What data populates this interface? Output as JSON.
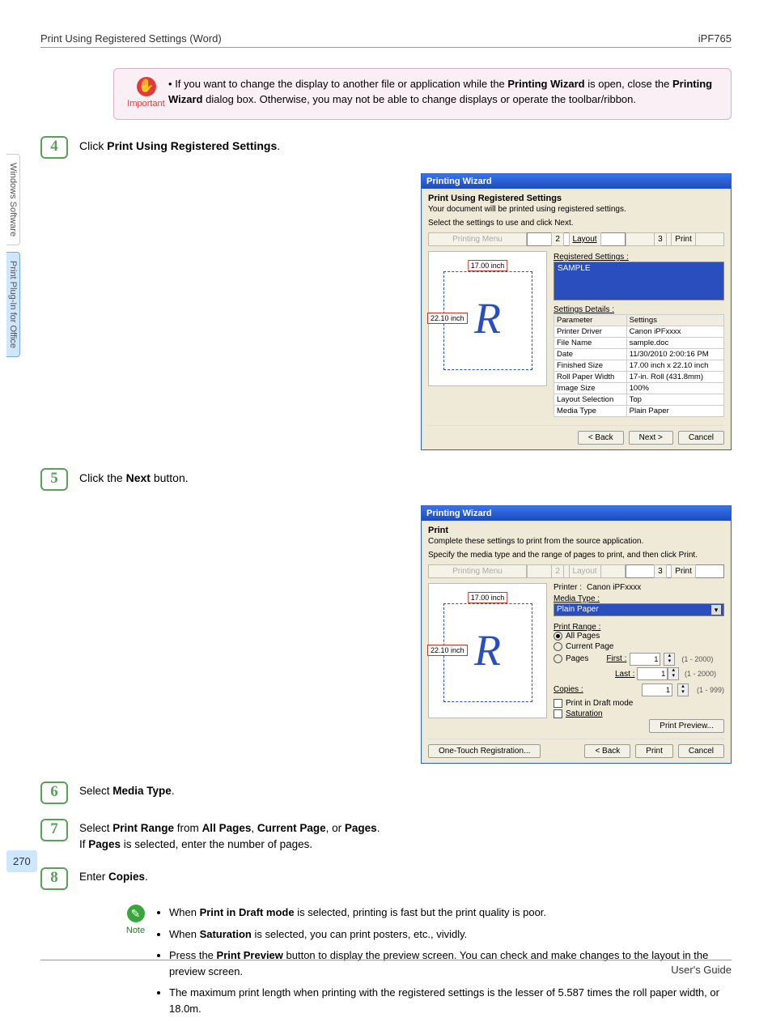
{
  "header": {
    "left": "Print Using Registered Settings (Word)",
    "right": "iPF765"
  },
  "side": {
    "tab1": "Windows Software",
    "tab2": "Print Plug-In for Office"
  },
  "important": {
    "label": "Important",
    "bullet": "•",
    "text_before": "If you want to change the display to another file or application while the ",
    "bold1": "Printing Wizard",
    "mid": " is open, close the ",
    "bold2": "Printing Wizard",
    "after": " dialog box. Otherwise, you may not be able to change displays or operate the toolbar/ribbon."
  },
  "steps": {
    "s4": {
      "num": "4",
      "pre": "Click ",
      "bold": "Print Using Registered Settings",
      "post": "."
    },
    "s5": {
      "num": "5",
      "pre": "Click the ",
      "bold": "Next",
      "post": " button."
    },
    "s6": {
      "num": "6",
      "pre": "Select ",
      "bold": "Media Type",
      "post": "."
    },
    "s7": {
      "num": "7",
      "l1_pre": "Select ",
      "l1_b1": "Print Range",
      "l1_mid": " from ",
      "l1_b2": "All Pages",
      "l1_c": ", ",
      "l1_b3": "Current Page",
      "l1_c2": ", or ",
      "l1_b4": "Pages",
      "l1_post": ".",
      "l2_pre": "If ",
      "l2_b": "Pages",
      "l2_post": " is selected, enter the number of pages."
    },
    "s8": {
      "num": "8",
      "pre": "Enter ",
      "bold": "Copies",
      "post": "."
    }
  },
  "note": {
    "label": "Note",
    "b1_pre": "When ",
    "b1_b": "Print in Draft mode",
    "b1_post": " is selected, printing is fast but the print quality is poor.",
    "b2_pre": "When ",
    "b2_b": "Saturation",
    "b2_post": " is selected, you can print posters, etc., vividly.",
    "b3_pre": "Press the ",
    "b3_b": "Print Preview",
    "b3_post": " button to display the preview screen. You can check and make changes to the layout in the preview screen.",
    "b4": "The maximum print length when printing with the registered settings is the lesser of 5.587 times the roll paper width, or 18.0m."
  },
  "wiz1": {
    "title": "Printing Wizard",
    "h": "Print Using Registered Settings",
    "sub1": "Your document will be printed using registered settings.",
    "sub2": "Select the settings to use and click Next.",
    "crumb1": "Printing Menu",
    "crumb2n": "2",
    "crumb2": "Layout",
    "crumb3n": "3",
    "crumb3": "Print",
    "szTop": "17.00 inch",
    "szLeft": "22.10 inch",
    "glyph": "R",
    "regLabel": "Registered Settings :",
    "regItem": "SAMPLE",
    "detLabel": "Settings Details :",
    "th1": "Parameter",
    "th2": "Settings",
    "rows": [
      [
        "Printer Driver",
        "Canon iPFxxxx"
      ],
      [
        "File Name",
        "sample.doc"
      ],
      [
        "Date",
        "11/30/2010 2:00:16 PM"
      ],
      [
        "Finished Size",
        "17.00 inch x 22.10 inch"
      ],
      [
        "Roll Paper Width",
        "17-in. Roll (431.8mm)"
      ],
      [
        "Image Size",
        "100%"
      ],
      [
        "Layout Selection",
        "Top"
      ],
      [
        "Media Type",
        "Plain Paper"
      ]
    ],
    "back": "< Back",
    "next": "Next >",
    "cancel": "Cancel"
  },
  "wiz2": {
    "title": "Printing Wizard",
    "h": "Print",
    "sub1": "Complete these settings to print from the source application.",
    "sub2": "Specify the media type and the range of pages to print, and then click Print.",
    "crumb1": "Printing Menu",
    "crumb2n": "2",
    "crumb2": "Layout",
    "crumb3n": "3",
    "crumb3": "Print",
    "szTop": "17.00 inch",
    "szLeft": "22.10 inch",
    "glyph": "R",
    "printerLbl": "Printer :",
    "printerVal": "Canon iPFxxxx",
    "mediaLbl": "Media Type :",
    "mediaVal": "Plain Paper",
    "rangeLbl": "Print Range :",
    "optAll": "All Pages",
    "optCur": "Current Page",
    "optPages": "Pages",
    "firstLbl": "First :",
    "lastLbl": "Last :",
    "firstVal": "1",
    "lastVal": "1",
    "firstRange": "(1 - 2000)",
    "lastRange": "(1 - 2000)",
    "copiesLbl": "Copies :",
    "copiesVal": "1",
    "copiesRange": "(1 - 999)",
    "chkDraft": "Print in Draft mode",
    "chkSat": "Saturation",
    "preview": "Print Preview...",
    "oneTouch": "One-Touch Registration...",
    "back": "< Back",
    "print": "Print",
    "cancel": "Cancel"
  },
  "pageNumber": "270",
  "footer": "User's Guide"
}
